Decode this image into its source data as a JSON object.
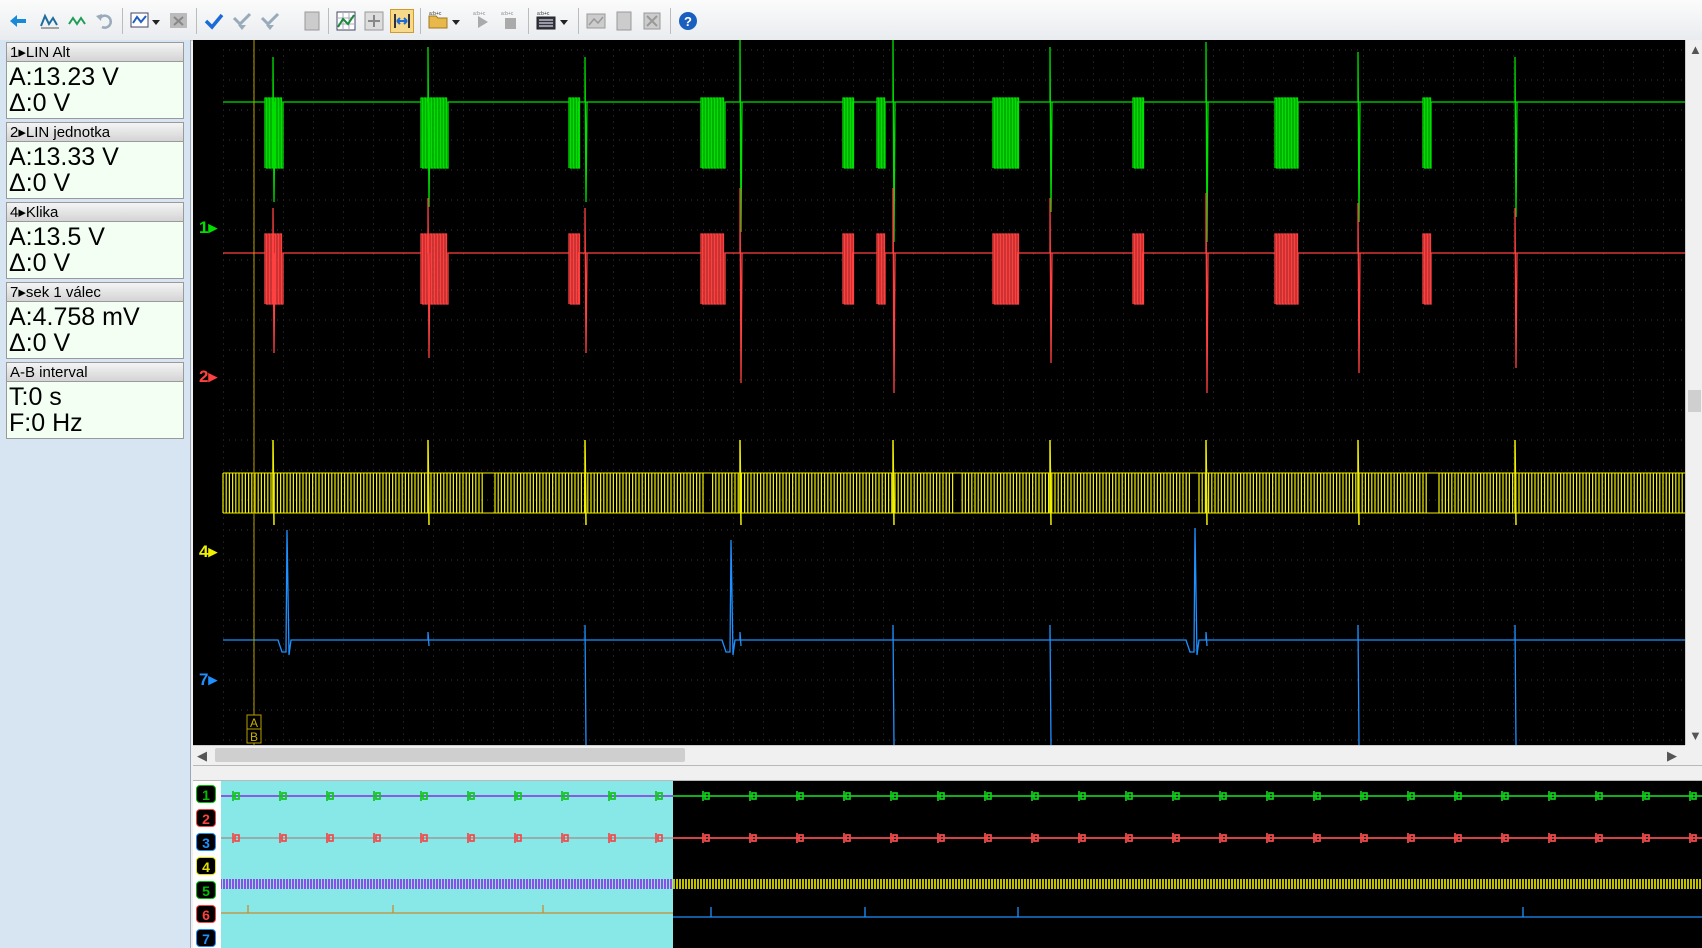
{
  "toolbar": {
    "icons": [
      "cursor-icon",
      "wave-icon",
      "wave-alt-icon",
      "undo-icon",
      "zoom-chart-icon",
      "dropdown-arrow",
      "close-chart-icon",
      "check-icon",
      "check-down-icon",
      "check-down2-icon",
      "page-icon",
      "grid-zoom-icon",
      "move-chart-icon",
      "measure-icon",
      "open-folder-icon",
      "dropdown-arrow",
      "play-sequence-icon",
      "stop-sequence-icon",
      "display-settings-icon",
      "dropdown-arrow",
      "image-icon",
      "doc-icon",
      "close-doc-icon",
      "help-icon"
    ]
  },
  "channels": [
    {
      "label": "1▸LIN Alt",
      "line1": "A:13.23 V",
      "line2": "Δ:0 V"
    },
    {
      "label": "2▸LIN jednotka",
      "line1": "A:13.33 V",
      "line2": "Δ:0 V"
    },
    {
      "label": "4▸Klika",
      "line1": "A:13.5 V",
      "line2": "Δ:0 V"
    },
    {
      "label": "7▸sek 1 válec",
      "line1": "A:4.758 mV",
      "line2": "Δ:0 V"
    },
    {
      "label": "A-B interval",
      "line1": "T:0 s",
      "line2": "F:0 Hz"
    }
  ],
  "scope": {
    "markers": [
      {
        "label": "1▸",
        "color": "#00e000"
      },
      {
        "label": "2▸",
        "color": "#ff4040"
      },
      {
        "label": "4▸",
        "color": "#f0f000"
      },
      {
        "label": "7▸",
        "color": "#1e90ff"
      }
    ],
    "cursor_labels": [
      "A",
      "B"
    ]
  },
  "overview": {
    "labels": [
      {
        "text": "1",
        "color": "#00e000"
      },
      {
        "text": "2",
        "color": "#ff4040"
      },
      {
        "text": "3",
        "color": "#1e90ff"
      },
      {
        "text": "4",
        "color": "#f0f000"
      },
      {
        "text": "5",
        "color": "#00e000"
      },
      {
        "text": "6",
        "color": "#ff4040"
      },
      {
        "text": "7",
        "color": "#1e90ff"
      }
    ]
  },
  "colors": {
    "green": "#00e000",
    "red": "#ff4040",
    "yellow": "#f0f000",
    "blue": "#1e90ff",
    "selection": "#88e8e8"
  }
}
